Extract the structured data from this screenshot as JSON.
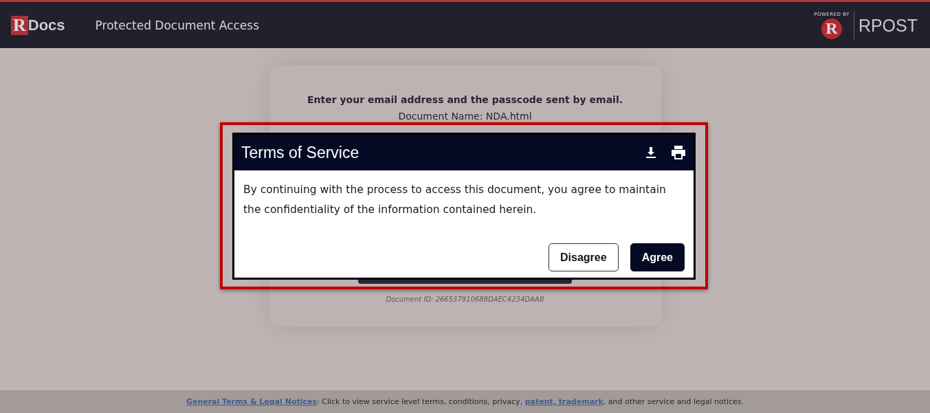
{
  "header": {
    "logo_letter": "R",
    "logo_text": "Docs",
    "title": "Protected Document Access",
    "partner_caption": "POWERED BY",
    "partner_letter": "R",
    "partner_name": "RPOST"
  },
  "card": {
    "instruction": "Enter your email address and the passcode sent by email.",
    "document_name": "Document Name: NDA.html",
    "document_id": "Document ID: 266537910688DAEC4234DAAB"
  },
  "dialog": {
    "title": "Terms of Service",
    "message": "By continuing with the process to access this document, you agree to maintain the confidentiality of the information contained herein.",
    "buttons": [
      {
        "label": "Disagree",
        "kind": "secondary"
      },
      {
        "label": "Agree",
        "kind": "primary"
      }
    ]
  },
  "footer": {
    "link": "General Terms & Legal Notices",
    "text_before": ": Click to view service level terms, conditions, privacy, ",
    "link_2": "patent, trademark",
    "text_after": ", and other service and legal notices."
  }
}
